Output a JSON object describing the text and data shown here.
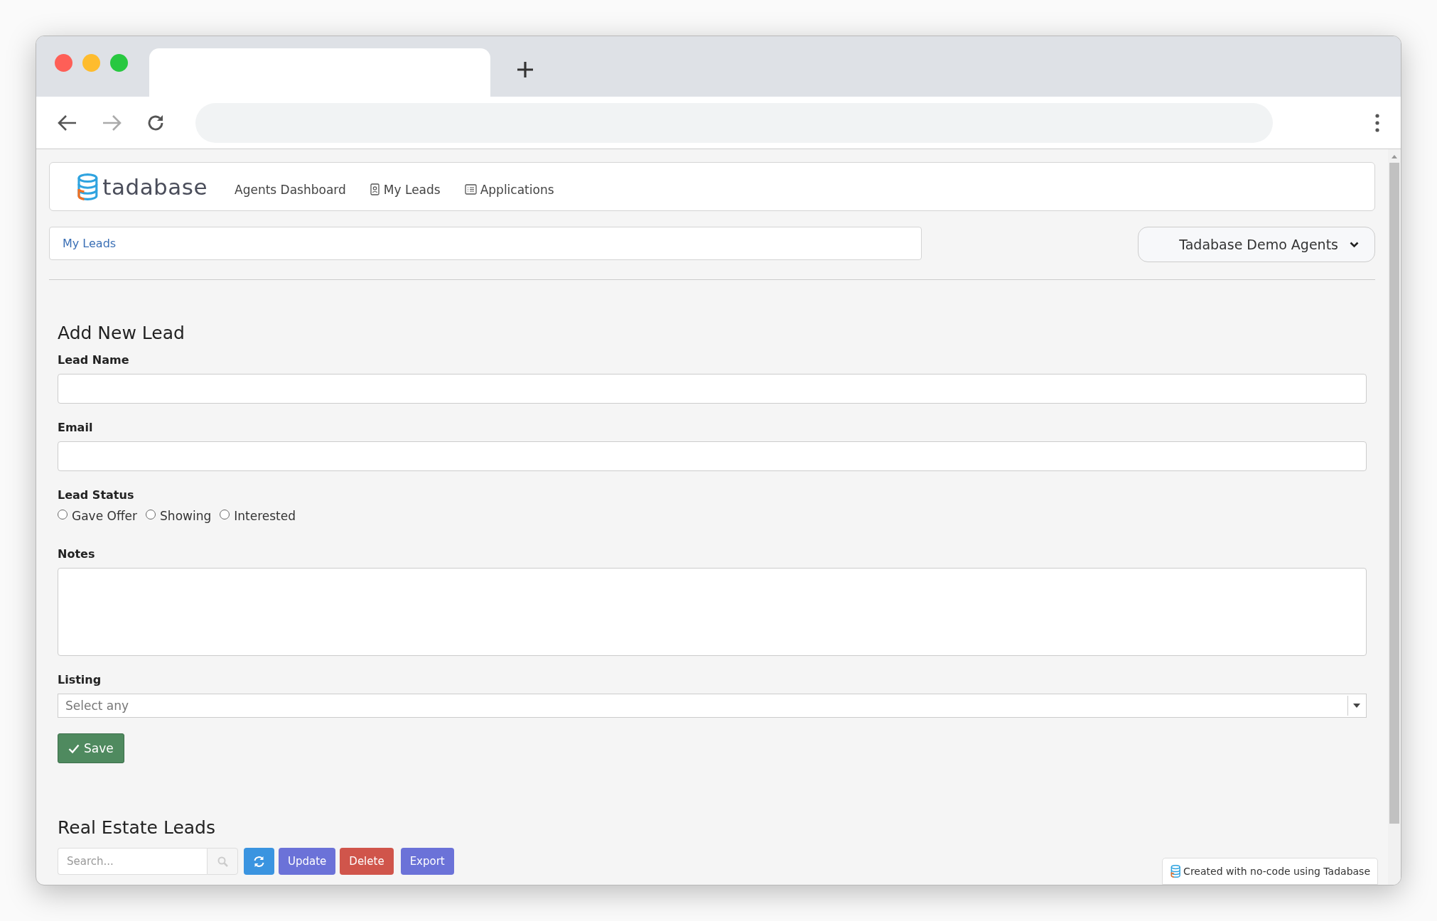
{
  "app": {
    "logo_text": "tadabase"
  },
  "nav": {
    "items": [
      {
        "label": "Agents Dashboard",
        "kind": "plain"
      },
      {
        "label": "My Leads",
        "kind": "contact"
      },
      {
        "label": "Applications",
        "kind": "list"
      }
    ]
  },
  "breadcrumb": {
    "label": "My Leads"
  },
  "account_menu": {
    "label": "Tadabase Demo Agents"
  },
  "form": {
    "title": "Add New Lead",
    "fields": [
      {
        "kind": "text",
        "label": "Lead Name"
      },
      {
        "kind": "text",
        "label": "Email"
      },
      {
        "kind": "radio",
        "label": "Lead Status",
        "options": [
          {
            "label": "Gave Offer",
            "selected": false
          },
          {
            "label": "Showing",
            "selected": false
          },
          {
            "label": "Interested",
            "selected": false
          }
        ]
      },
      {
        "kind": "textarea",
        "label": "Notes"
      },
      {
        "kind": "select",
        "label": "Listing",
        "placeholder": "Select any"
      }
    ],
    "save_button": "Save"
  },
  "table_section": {
    "title": "Real Estate Leads",
    "search": {
      "placeholder": "Search..."
    },
    "buttons": [
      {
        "label": "Update",
        "color": "#6b72d8"
      },
      {
        "label": "Delete",
        "color": "#d0554b"
      },
      {
        "label": "Export",
        "color": "#6b72d8"
      }
    ]
  },
  "footer_badge": {
    "text": "Created with no-code using Tadabase"
  }
}
